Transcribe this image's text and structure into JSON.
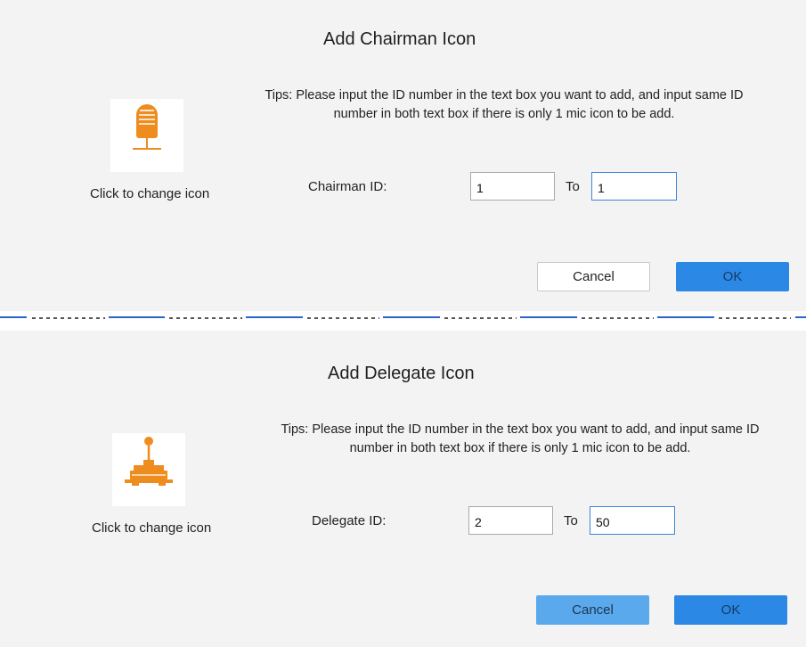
{
  "chairman_dialog": {
    "title": "Add Chairman Icon",
    "tips": "Tips: Please input the ID number in the text box you want to add, and input same ID number in both text box if there is only 1 mic icon to be add.",
    "icon": "microphone-icon",
    "change_icon_label": "Click to change icon",
    "id_label": "Chairman ID:",
    "from_value": "1",
    "to_label": "To",
    "to_value": "1",
    "cancel_label": "Cancel",
    "ok_label": "OK"
  },
  "delegate_dialog": {
    "title": "Add Delegate Icon",
    "tips": "Tips: Please input the ID number in the text box you want to add, and input same ID number in both text box if there is only 1 mic icon to be add.",
    "icon": "delegate-mic-icon",
    "change_icon_label": "Click to change icon",
    "id_label": "Delegate ID:",
    "from_value": "2",
    "to_label": "To",
    "to_value": "50",
    "cancel_label": "Cancel",
    "ok_label": "OK"
  },
  "colors": {
    "background": "#f3f3f3",
    "icon_orange": "#ef8c1e",
    "ok_blue": "#2b89e5",
    "cancel_blue": "#5aa9ec",
    "separator_blue": "#2b63c7"
  }
}
